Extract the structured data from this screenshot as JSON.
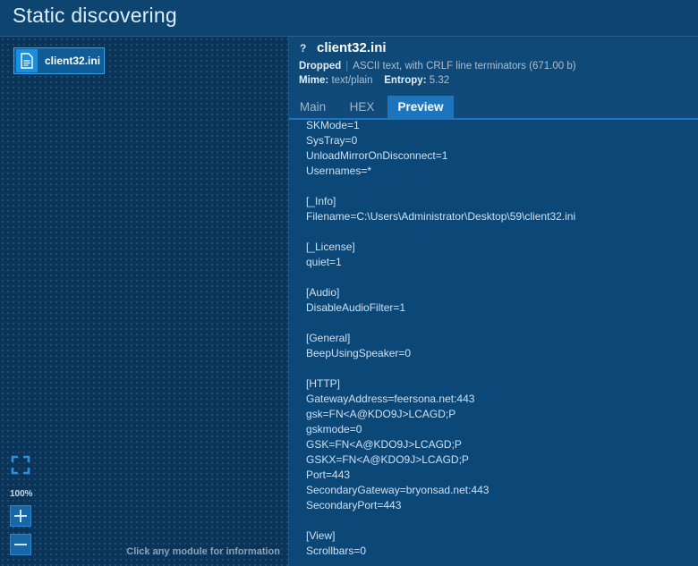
{
  "header": {
    "title": "Static discovering"
  },
  "canvas": {
    "module": {
      "label": "client32.ini",
      "icon": "document-icon"
    },
    "zoom": {
      "level": "100%"
    },
    "hint": "Click any module for information"
  },
  "file": {
    "help_glyph": "?",
    "name": "client32.ini",
    "dropped_label": "Dropped",
    "description": "ASCII text, with CRLF line terminators (671.00 b)",
    "mime_label": "Mime:",
    "mime_value": "text/plain",
    "entropy_label": "Entropy:",
    "entropy_value": "5.32"
  },
  "tabs": [
    {
      "label": "Main",
      "active": false
    },
    {
      "label": "HEX",
      "active": false
    },
    {
      "label": "Preview",
      "active": true
    }
  ],
  "preview": {
    "text": "SKMode=1\nSysTray=0\nUnloadMirrorOnDisconnect=1\nUsernames=*\n\n[_Info]\nFilename=C:\\Users\\Administrator\\Desktop\\59\\client32.ini\n\n[_License]\nquiet=1\n\n[Audio]\nDisableAudioFilter=1\n\n[General]\nBeepUsingSpeaker=0\n\n[HTTP]\nGatewayAddress=feersona.net:443\ngsk=FN<A@KDO9J>LCAGD;P\ngskmode=0\nGSK=FN<A@KDO9J>LCAGD;P\nGSKX=FN<A@KDO9J>LCAGD;P\nPort=443\nSecondaryGateway=bryonsad.net:443\nSecondaryPort=443\n\n[View]\nScrollbars=0"
  },
  "colors": {
    "accent": "#1d76bd",
    "background": "#0b3a63"
  }
}
